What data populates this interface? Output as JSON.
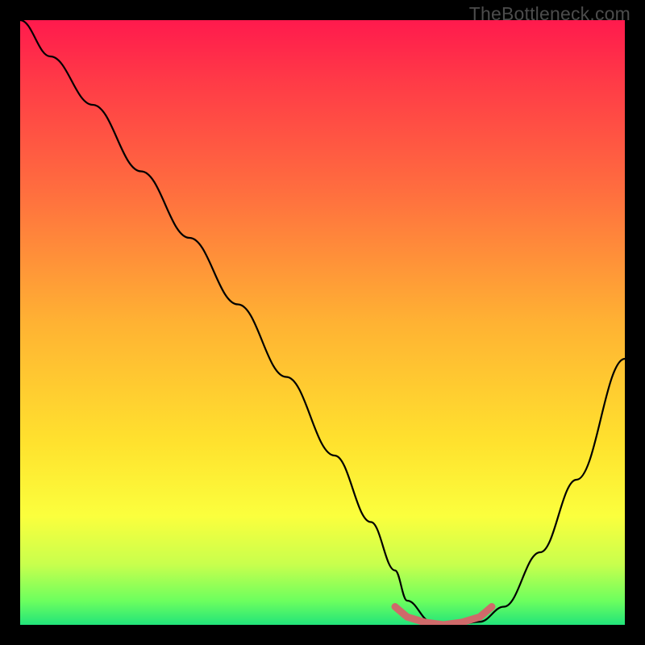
{
  "attribution": "TheBottleneck.com",
  "chart_data": {
    "type": "line",
    "title": "",
    "xlabel": "",
    "ylabel": "",
    "xlim": [
      0,
      100
    ],
    "ylim": [
      0,
      100
    ],
    "series": [
      {
        "name": "bottleneck-curve",
        "x": [
          0,
          5,
          12,
          20,
          28,
          36,
          44,
          52,
          58,
          62,
          64,
          68,
          72,
          76,
          80,
          86,
          92,
          100
        ],
        "y": [
          100,
          94,
          86,
          75,
          64,
          53,
          41,
          28,
          17,
          9,
          4,
          0.5,
          0,
          0.5,
          3,
          12,
          24,
          44
        ]
      }
    ],
    "marker": {
      "name": "optimal-range",
      "x": [
        62,
        64,
        67,
        70,
        73,
        76,
        78
      ],
      "y": [
        3,
        1.3,
        0.4,
        0,
        0.4,
        1.3,
        3
      ],
      "color": "#cf6a6a"
    },
    "gradient_stops": [
      {
        "pos": 0.0,
        "color": "#ff1a4d"
      },
      {
        "pos": 0.28,
        "color": "#ff6d3f"
      },
      {
        "pos": 0.5,
        "color": "#ffb233"
      },
      {
        "pos": 0.82,
        "color": "#fbff3d"
      },
      {
        "pos": 1.0,
        "color": "#22e47a"
      }
    ]
  }
}
